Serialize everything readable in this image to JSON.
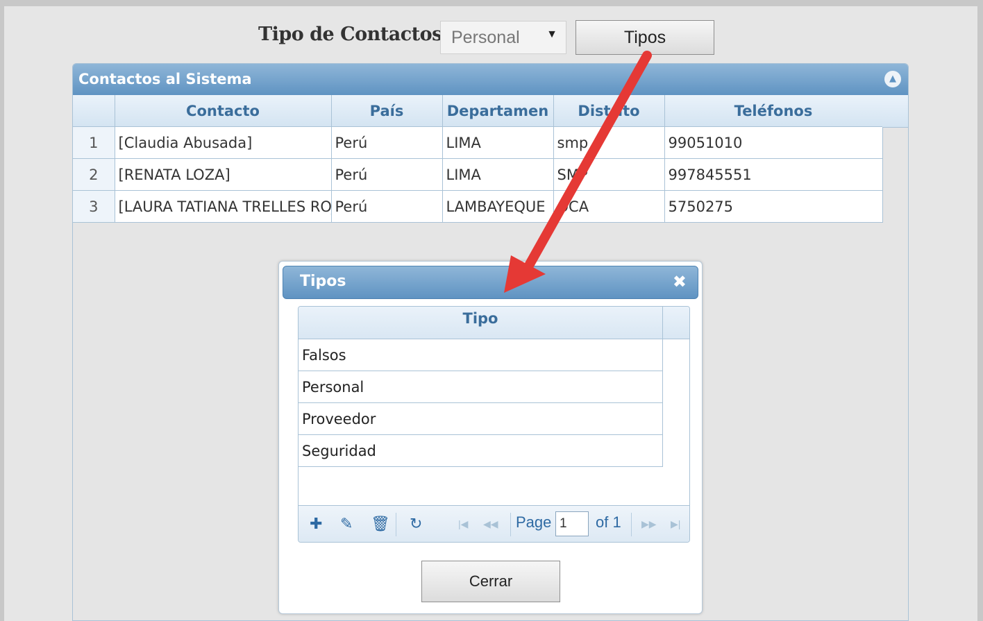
{
  "filter": {
    "label": "Tipo de Contactos:",
    "select_value": "Personal",
    "button_label": "Tipos"
  },
  "grid": {
    "caption": "Contactos al Sistema",
    "columns": [
      "Contacto",
      "País",
      "Departamen",
      "Distrito",
      "Teléfonos"
    ],
    "rows": [
      {
        "n": "1",
        "contacto": "[Claudia Abusada]",
        "pais": "Perú",
        "departamento": "LIMA",
        "distrito": "smp",
        "telefonos": "99051010"
      },
      {
        "n": "2",
        "contacto": "[RENATA LOZA]",
        "pais": "Perú",
        "departamento": "LIMA",
        "distrito": "SMP",
        "telefonos": "997845551"
      },
      {
        "n": "3",
        "contacto": "[LAURA TATIANA TRELLES ROJAS]",
        "pais": "Perú",
        "departamento": "LAMBAYEQUE",
        "distrito": "OCA",
        "telefonos": "5750275"
      }
    ]
  },
  "dialog": {
    "title": "Tipos",
    "column": "Tipo",
    "items": [
      "Falsos",
      "Personal",
      "Proveedor",
      "Seguridad"
    ],
    "pager": {
      "page_label": "Page",
      "page_value": "1",
      "of_label": "of 1"
    },
    "close_button": "Cerrar"
  },
  "annotation": {
    "arrow_color": "#e53935"
  },
  "colors": {
    "header_blue": "#5f93c2",
    "header_text": "#3a6d9b"
  }
}
